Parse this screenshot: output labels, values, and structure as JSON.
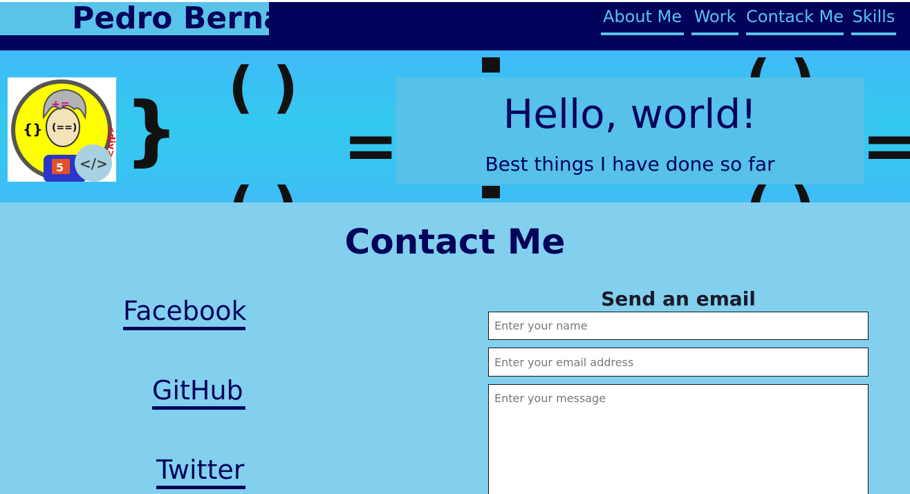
{
  "header": {
    "brand": "Pedro Bernal",
    "nav": [
      {
        "label": "About Me"
      },
      {
        "label": "Work"
      },
      {
        "label": "Contack Me"
      },
      {
        "label": "Skills"
      }
    ]
  },
  "hero": {
    "title": "Hello, world!",
    "subtitle": "Best things I have done so far",
    "avatar_stickers": [
      "+=",
      "(==)",
      "{}",
      "<div>",
      "5",
      "</>"
    ]
  },
  "contact": {
    "title": "Contact Me",
    "social_links": [
      {
        "label": "Facebook"
      },
      {
        "label": "GitHub"
      },
      {
        "label": "Twitter"
      }
    ],
    "form": {
      "title": "Send an email",
      "name_placeholder": "Enter your name",
      "email_placeholder": "Enter your email address",
      "message_placeholder": "Enter your message"
    }
  },
  "colors": {
    "navy": "#01025a",
    "sky": "#5ac3ea",
    "page_bg": "#82d0ee",
    "hero_bg": "#3fbaf7"
  }
}
